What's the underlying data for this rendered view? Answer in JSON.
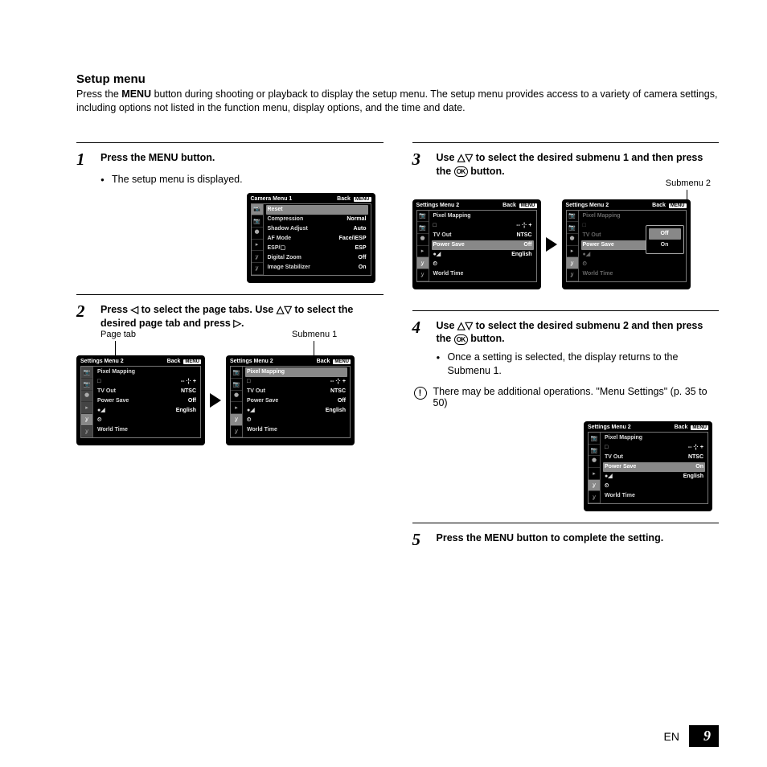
{
  "title": "Setup menu",
  "intro": {
    "a": "Press the ",
    "menu": "MENU",
    "b": " button during shooting or playback to display the setup menu. The setup menu provides access to a variety of camera settings, including options not listed in the function menu, display options, and the time and date."
  },
  "steps": {
    "1": {
      "num": "1",
      "text_a": "Press the ",
      "menu": "MENU",
      "text_b": " button.",
      "bullet": "The setup menu is displayed."
    },
    "2": {
      "num": "2",
      "text": "Press ◁ to select the page tabs. Use △▽ to select the desired page tab and press ▷."
    },
    "3": {
      "num": "3",
      "text_a": "Use △▽ to select the desired submenu 1 and then press the ",
      "ok": "OK",
      "text_b": " button."
    },
    "4": {
      "num": "4",
      "text_a": "Use △▽ to select the desired submenu 2 and then press the ",
      "ok": "OK",
      "text_b": " button.",
      "bullet": "Once a setting is selected, the display returns to the Submenu 1."
    },
    "5": {
      "num": "5",
      "text_a": "Press the ",
      "menu": "MENU",
      "text_b": " button to complete the setting."
    }
  },
  "note": "There may be additional operations. \"Menu Settings\" (p. 35 to 50)",
  "labels": {
    "page_tab": "Page tab",
    "submenu1": "Submenu 1",
    "submenu2": "Submenu 2"
  },
  "screen_back": "Back",
  "screen_menu": "MENU",
  "screens": {
    "camera1": {
      "title": "Camera Menu 1",
      "rows": [
        {
          "l": "Reset",
          "v": "",
          "hl": true
        },
        {
          "l": "Compression",
          "v": "Normal"
        },
        {
          "l": "Shadow Adjust",
          "v": "Auto"
        },
        {
          "l": "AF Mode",
          "v": "Face/iESP"
        },
        {
          "l": "ESP/▢",
          "v": "ESP"
        },
        {
          "l": "Digital Zoom",
          "v": "Off"
        },
        {
          "l": "Image Stabilizer",
          "v": "On"
        }
      ],
      "active_tab": 0
    },
    "settings2_a": {
      "title": "Settings Menu 2",
      "rows": [
        {
          "l": "Pixel Mapping",
          "v": ""
        },
        {
          "l": "□",
          "v": "-- ·¦· +"
        },
        {
          "l": "TV Out",
          "v": "NTSC"
        },
        {
          "l": "Power Save",
          "v": "Off"
        },
        {
          "l": "●◢",
          "v": "English"
        },
        {
          "l": "⏲",
          "v": ""
        },
        {
          "l": "World Time",
          "v": ""
        }
      ],
      "active_tab": 4,
      "tab_col_hl": true
    },
    "settings2_b": {
      "title": "Settings Menu 2",
      "rows": [
        {
          "l": "Pixel Mapping",
          "v": "",
          "hl": true
        },
        {
          "l": "□",
          "v": "-- ·¦· +"
        },
        {
          "l": "TV Out",
          "v": "NTSC"
        },
        {
          "l": "Power Save",
          "v": "Off"
        },
        {
          "l": "●◢",
          "v": "English"
        },
        {
          "l": "⏲",
          "v": ""
        },
        {
          "l": "World Time",
          "v": ""
        }
      ],
      "active_tab": 4
    },
    "settings2_c": {
      "title": "Settings Menu 2",
      "rows": [
        {
          "l": "Pixel Mapping",
          "v": ""
        },
        {
          "l": "□",
          "v": "-- ·¦· +"
        },
        {
          "l": "TV Out",
          "v": "NTSC"
        },
        {
          "l": "Power Save",
          "v": "Off",
          "hl": true
        },
        {
          "l": "●◢",
          "v": "English"
        },
        {
          "l": "⏲",
          "v": ""
        },
        {
          "l": "World Time",
          "v": ""
        }
      ],
      "active_tab": 4
    },
    "settings2_d_dim": {
      "title": "Settings Menu 2",
      "rows": [
        {
          "l": "Pixel Mapping",
          "v": "",
          "dim": true
        },
        {
          "l": "□",
          "v": "",
          "dim": true
        },
        {
          "l": "TV Out",
          "v": "",
          "dim": true
        },
        {
          "l": "Power Save",
          "v": "",
          "hl": true
        },
        {
          "l": "●◢",
          "v": "",
          "dim": true
        },
        {
          "l": "⏲",
          "v": "",
          "dim": true
        },
        {
          "l": "World Time",
          "v": "",
          "dim": true
        }
      ],
      "active_tab": 4,
      "popup": {
        "opts": [
          "Off",
          "On"
        ],
        "sel": 0
      }
    },
    "settings2_final": {
      "title": "Settings Menu 2",
      "rows": [
        {
          "l": "Pixel Mapping",
          "v": ""
        },
        {
          "l": "□",
          "v": "-- ·¦· +"
        },
        {
          "l": "TV Out",
          "v": "NTSC"
        },
        {
          "l": "Power Save",
          "v": "On",
          "hl": true
        },
        {
          "l": "●◢",
          "v": "English"
        },
        {
          "l": "⏲",
          "v": ""
        },
        {
          "l": "World Time",
          "v": ""
        }
      ],
      "active_tab": 4
    }
  },
  "tabs_icons": [
    "📷",
    "📷",
    "⯃",
    "▸",
    "ỿ",
    "ỿ"
  ],
  "footer": {
    "lang": "EN",
    "page": "9"
  }
}
